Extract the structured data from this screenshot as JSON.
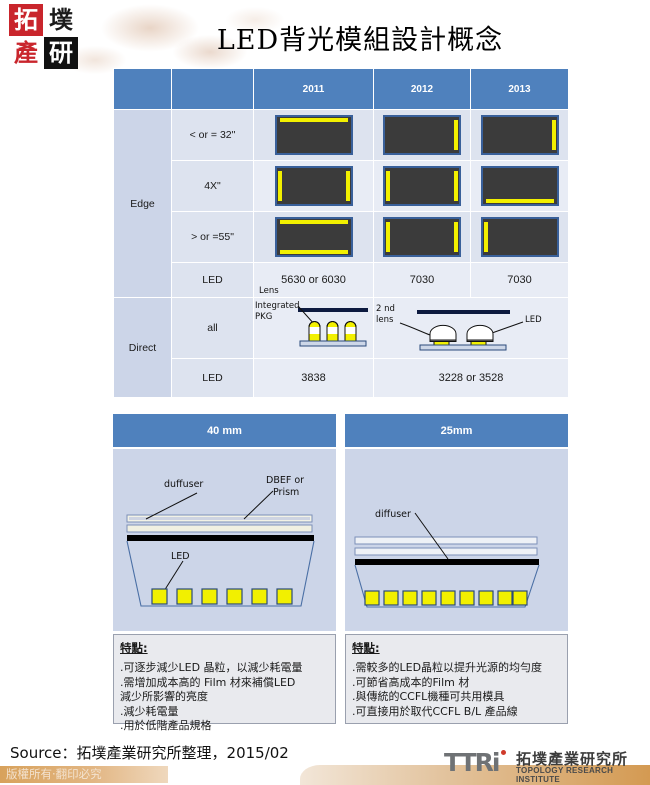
{
  "brand": {
    "logo_chars": [
      "拓",
      "墣",
      "產",
      "研"
    ],
    "wordmark_letters": "TTRi",
    "wordmark_cn": "拓墣產業研究所",
    "wordmark_en": "TOPOLOGY RESEARCH INSTITUTE"
  },
  "title": "LED背光模組設計概念",
  "colors": {
    "header_blue": "#4f81bd",
    "row_light": "#e8ecf5",
    "row_mid": "#dde3ef",
    "label_col": "#ccd5e8",
    "led_yellow": "#f2f000",
    "panel_dark": "#3b3b3b",
    "panel_border": "#39609a"
  },
  "table": {
    "columns": [
      "",
      "",
      "2011",
      "2012",
      "2013"
    ],
    "groups": [
      {
        "name": "Edge",
        "rows": [
          {
            "label": "< or = 32\"",
            "cells": [
              "panel-top",
              "panel-right",
              "panel-right"
            ]
          },
          {
            "label": "4X\"",
            "cells": [
              "panel-left-right",
              "panel-left-right",
              "panel-bottom"
            ]
          },
          {
            "label": "> or =55\"",
            "cells": [
              "panel-top-bottom",
              "panel-left-right",
              "panel-left"
            ]
          }
        ],
        "led_row": {
          "label": "LED",
          "values": [
            "5630 or 6030",
            "7030",
            "7030"
          ]
        }
      },
      {
        "name": "Direct",
        "rows": [
          {
            "label": "all",
            "cells": [
              "diagram-integrated-pkg",
              "diagram-2nd-lens"
            ]
          }
        ],
        "led_row": {
          "label": "LED",
          "values": [
            "3838",
            "3228 or 3528"
          ]
        }
      }
    ],
    "diagram_labels": {
      "lens": "Lens",
      "integrated": "Integrated",
      "pkg": "PKG",
      "second": "2 nd",
      "lens2": "lens",
      "led": "LED"
    }
  },
  "comparison": [
    {
      "title": "40 mm",
      "diagram_labels": {
        "diffuser": "duffuser",
        "film": "DBEF or",
        "film2": "Prism",
        "led": "LED"
      },
      "led_count": 6,
      "notes_title": "特點:",
      "notes": [
        ".可逐步減少LED 晶粒，以減少耗電量",
        ".需增加成本高的 Film 材來補償LED",
        "減少所影響的亮度",
        ".減少耗電量",
        ".用於低階產品規格"
      ]
    },
    {
      "title": "25mm",
      "diagram_labels": {
        "diffuser": "diffuser"
      },
      "led_count": 9,
      "notes_title": "特點:",
      "notes": [
        ".需較多的LED晶粒以提升光源的均勻度",
        ".可節省高成本的Film 材",
        ".與傳統的CCFL機種可共用模具",
        ".可直接用於取代CCFL B/L 產品線"
      ]
    }
  ],
  "footer": {
    "source": "Source：拓墣產業研究所整理，2015/02",
    "copyright": "版權所有‧翻印必究"
  }
}
